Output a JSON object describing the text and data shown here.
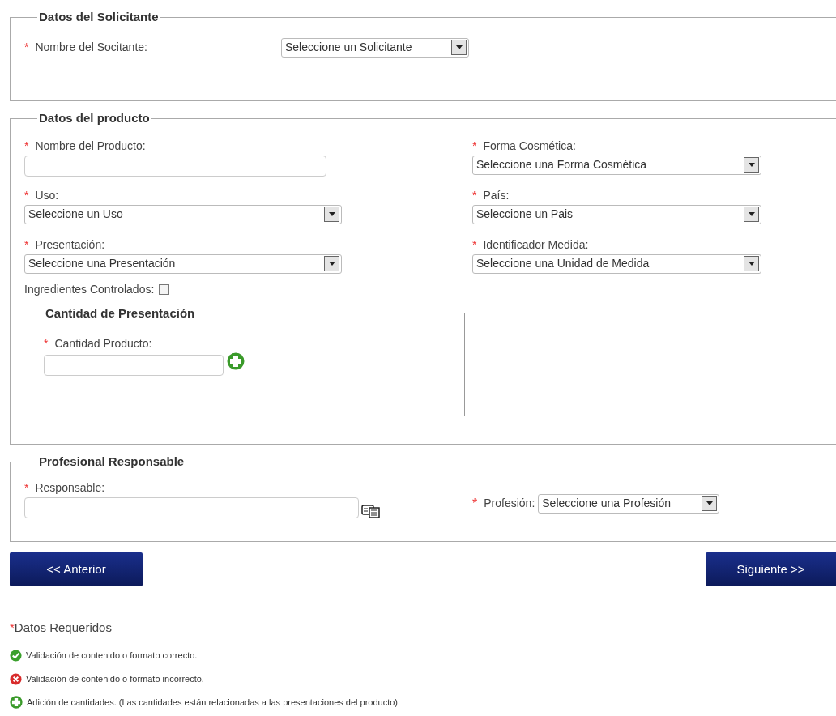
{
  "required_mark": "*",
  "applicant": {
    "legend": "Datos del Solicitante",
    "field": {
      "label": "Nombre del Socitante:",
      "required": true,
      "value": "Seleccione un Solicitante"
    }
  },
  "product": {
    "legend": "Datos del producto",
    "left": [
      {
        "kind": "text",
        "label": "Nombre del Producto:",
        "required": true
      },
      {
        "kind": "select",
        "label": "Uso:",
        "required": true,
        "value": "Seleccione un Uso"
      },
      {
        "kind": "select",
        "label": "Presentación:",
        "required": true,
        "value": "Seleccione una Presentación"
      }
    ],
    "right": [
      {
        "kind": "select",
        "label": "Forma Cosmética:",
        "required": true,
        "value": "Seleccione una Forma Cosmética"
      },
      {
        "kind": "select",
        "label": "País:",
        "required": true,
        "value": "Seleccione un Pais"
      },
      {
        "kind": "select",
        "label": "Identificador Medida:",
        "required": true,
        "value": "Seleccione una Unidad de Medida"
      }
    ],
    "controlled": {
      "label": "Ingredientes Controlados:",
      "checked": false
    },
    "quantity": {
      "legend": "Cantidad de Presentación",
      "label": "Cantidad Producto:",
      "required": true
    }
  },
  "professional": {
    "legend": "Profesional Responsable",
    "responsible": {
      "label": "Responsable:",
      "required": true
    },
    "profession": {
      "label": "Profesión:",
      "required": true,
      "value": "Seleccione una Profesión"
    }
  },
  "buttons": {
    "back": "<< Anterior",
    "next": "Siguiente >>"
  },
  "legend": {
    "required": "Datos Requeridos",
    "items": [
      {
        "kind": "ok",
        "text": "Validación de contenido o formato correcto."
      },
      {
        "kind": "error",
        "text": "Validación de contenido o formato incorrecto."
      },
      {
        "kind": "add",
        "text": "Adición de cantidades. (Las cantidades están relacionadas a las presentaciones del producto)"
      }
    ]
  }
}
